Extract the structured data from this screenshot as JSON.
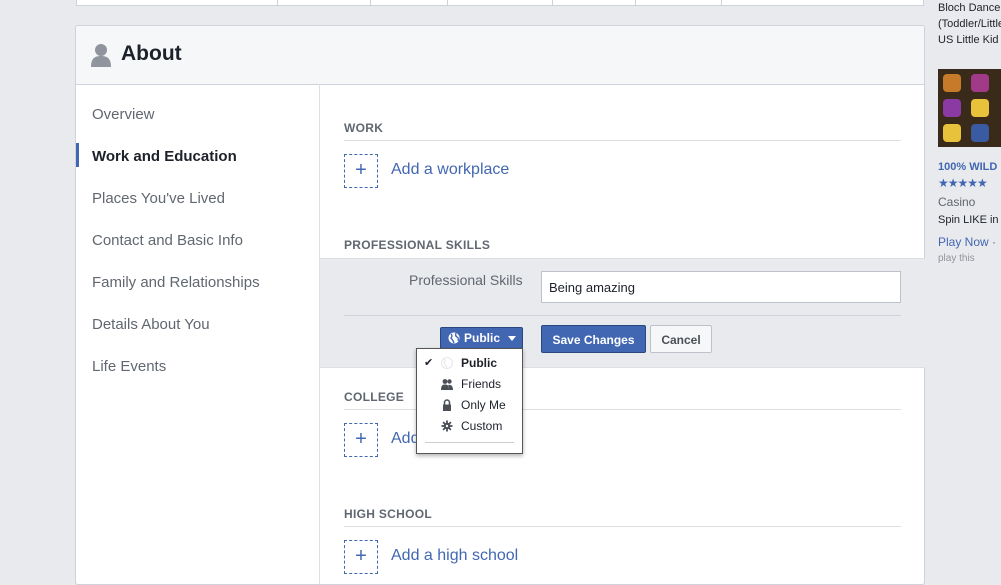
{
  "about": {
    "title": "About",
    "nav": [
      {
        "label": "Overview"
      },
      {
        "label": "Work and Education"
      },
      {
        "label": "Places You've Lived"
      },
      {
        "label": "Contact and Basic Info"
      },
      {
        "label": "Family and Relationships"
      },
      {
        "label": "Details About You"
      },
      {
        "label": "Life Events"
      }
    ],
    "active_nav": "Work and Education"
  },
  "work": {
    "title": "WORK",
    "add_label": "Add a workplace"
  },
  "professional_skills": {
    "title": "PROFESSIONAL SKILLS",
    "field_label": "Professional Skills",
    "field_value": "Being amazing",
    "privacy_label": "Public",
    "save_label": "Save Changes",
    "cancel_label": "Cancel"
  },
  "privacy_menu": {
    "items": [
      {
        "label": "Public",
        "icon": "globe-icon",
        "selected": true
      },
      {
        "label": "Friends",
        "icon": "friends-icon",
        "selected": false
      },
      {
        "label": "Only Me",
        "icon": "lock-icon",
        "selected": false
      },
      {
        "label": "Custom",
        "icon": "gear-icon",
        "selected": false
      }
    ],
    "check_glyph": "✔"
  },
  "college": {
    "title": "COLLEGE",
    "add_label_partial": "Add"
  },
  "high_school": {
    "title": "HIGH SCHOOL",
    "add_label": "Add a high school"
  },
  "add_glyph": "+",
  "sidebar": {
    "ad1_lines": [
      "Bloch Dance",
      "(Toddler/Little",
      "US Little Kid -"
    ],
    "ad2_title": "100% WILD",
    "ad2_stars": "★★★★★",
    "ad2_category": "Casino",
    "ad2_desc": "Spin LIKE in V",
    "ad2_cta": "Play Now ·",
    "ad2_sub": "play this"
  },
  "colors": {
    "accent": "#4267b2",
    "page_bg": "#e9eaed"
  }
}
